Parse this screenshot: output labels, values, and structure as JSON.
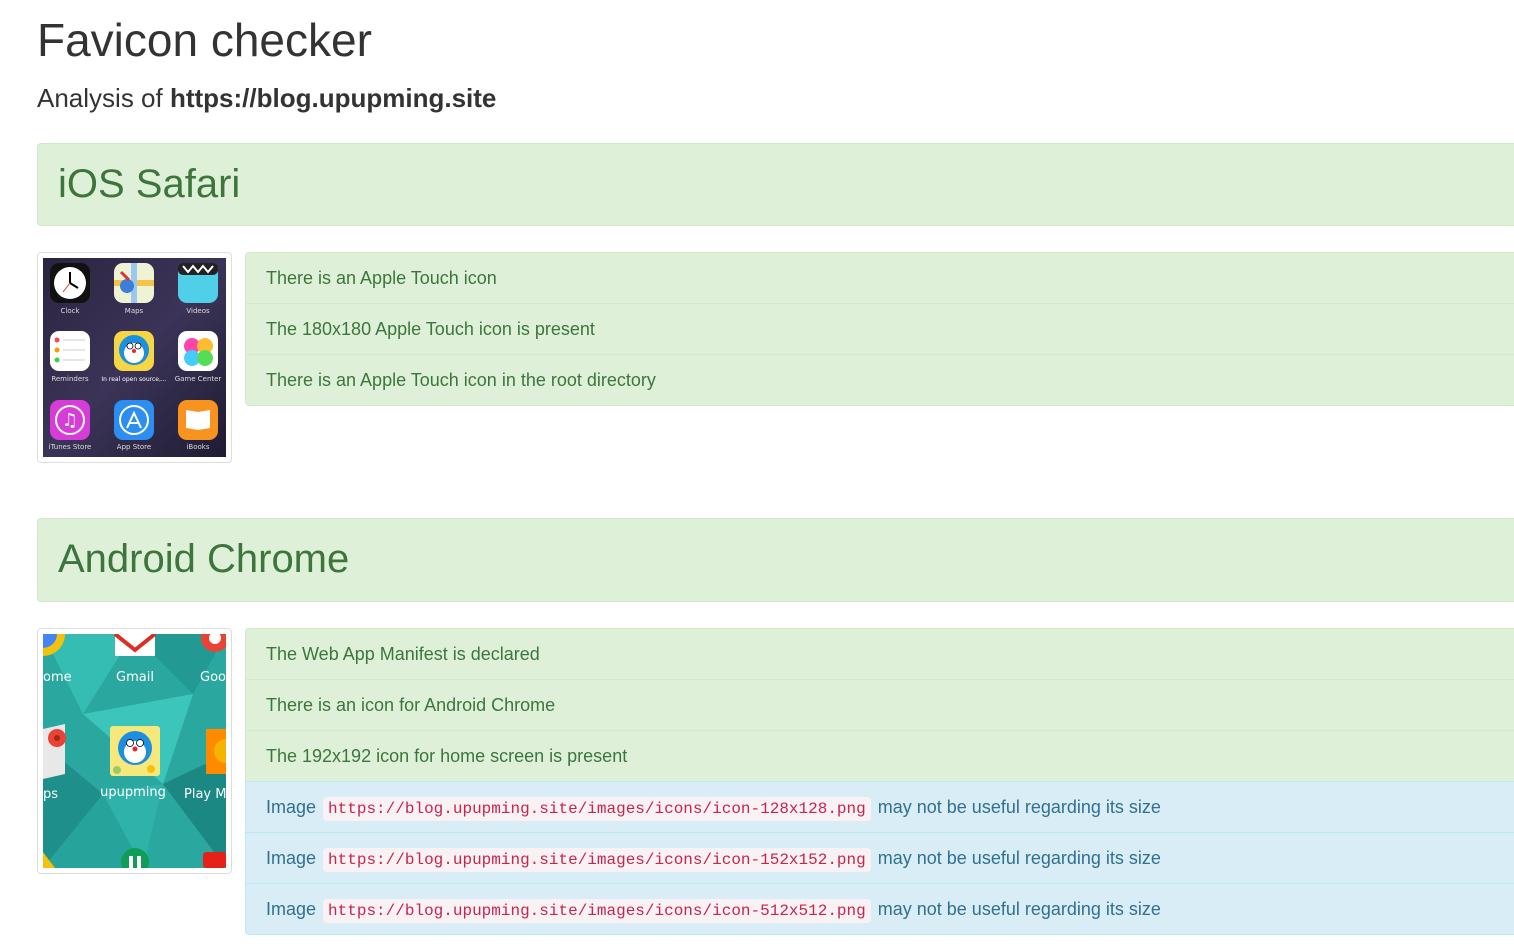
{
  "header": {
    "title": "Favicon checker",
    "analysis_prefix": "Analysis of",
    "analysis_url": "https://blog.upupming.site"
  },
  "sections": [
    {
      "title": "iOS Safari",
      "thumb_labels": [
        "Clock",
        "Maps",
        "Videos",
        "Reminders",
        "In real open source,...",
        "Game Center",
        "iTunes Store",
        "App Store",
        "iBooks"
      ],
      "items": [
        {
          "text": "There is an Apple Touch icon",
          "status": "ok"
        },
        {
          "text": "The 180x180 Apple Touch icon is present",
          "status": "ok"
        },
        {
          "text": "There is an Apple Touch icon in the root directory",
          "status": "ok"
        }
      ]
    },
    {
      "title": "Android Chrome",
      "thumb_labels": [
        "ome",
        "Gmail",
        "Goo",
        "ps",
        "upupming",
        "Play M"
      ],
      "items": [
        {
          "text": "The Web App Manifest is declared",
          "status": "ok"
        },
        {
          "text": "There is an icon for Android Chrome",
          "status": "ok"
        },
        {
          "text": "The 192x192 icon for home screen is present",
          "status": "ok"
        },
        {
          "prefix": "Image",
          "code": "https://blog.upupming.site/images/icons/icon-128x128.png",
          "suffix": "may not be useful regarding its size",
          "status": "info"
        },
        {
          "prefix": "Image",
          "code": "https://blog.upupming.site/images/icons/icon-152x152.png",
          "suffix": "may not be useful regarding its size",
          "status": "info"
        },
        {
          "prefix": "Image",
          "code": "https://blog.upupming.site/images/icons/icon-512x512.png",
          "suffix": "may not be useful regarding its size",
          "status": "info"
        }
      ]
    }
  ],
  "colors": {
    "success_bg": "#dff0d8",
    "success_text": "#3c763d",
    "info_bg": "#d9edf7",
    "info_text": "#31708f",
    "code_text": "#c7254e"
  }
}
